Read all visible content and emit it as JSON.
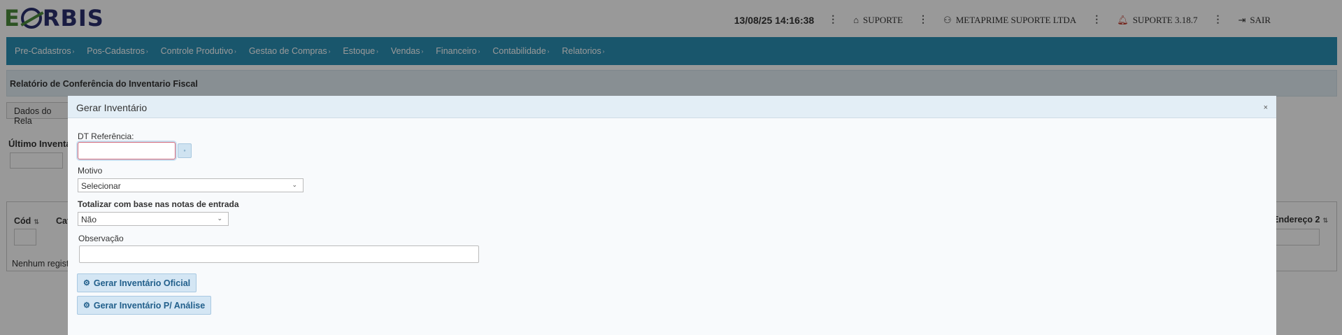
{
  "header": {
    "logo_text": "EORBIS",
    "datetime": "13/08/25 14:16:38",
    "support_link": "SUPORTE",
    "company": "METAPRIME SUPORTE LTDA",
    "version": "SUPORTE 3.18.7",
    "logout": "SAIR",
    "menu_dots": "⋮",
    "icons": {
      "home": "home-icon",
      "user": "user-icon",
      "bell": "bell-icon",
      "logout": "logout-icon"
    }
  },
  "nav": {
    "items": [
      {
        "label": "Pre-Cadastros"
      },
      {
        "label": "Pos-Cadastros"
      },
      {
        "label": "Controle Produtivo"
      },
      {
        "label": "Gestao de Compras"
      },
      {
        "label": "Estoque"
      },
      {
        "label": "Vendas"
      },
      {
        "label": "Financeiro"
      },
      {
        "label": "Contabilidade"
      },
      {
        "label": "Relatorios"
      }
    ],
    "color": "#2a8fb5"
  },
  "page": {
    "title": "Relatório de Conferência do Inventario Fiscal",
    "tab_label": "Dados do Rela",
    "ultimo_label": "Último Inventá",
    "table": {
      "col_cod": "Cód",
      "col_cat": "Cat",
      "col_endereco2": "Endereço 2",
      "empty_text": "Nenhum regist"
    }
  },
  "modal": {
    "title": "Gerar Inventário",
    "close": "×",
    "dt_label": "DT Referência:",
    "dt_value": "",
    "motivo_label": "Motivo",
    "motivo_value": "Selecionar",
    "totalizar_label": "Totalizar com base nas notas de entrada",
    "totalizar_value": "Não",
    "obs_label": "Observação",
    "obs_value": "",
    "btn_oficial": "Gerar Inventário Oficial",
    "btn_analise": "Gerar Inventário P/ Análise"
  }
}
